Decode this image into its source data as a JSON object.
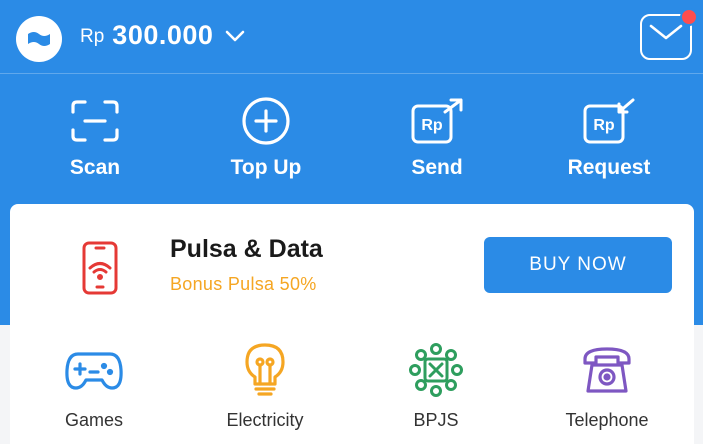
{
  "header": {
    "logo_icon": "wallet-logo-icon",
    "balance": {
      "currency": "Rp",
      "amount": "300.000"
    },
    "inbox_icon": "mail-icon",
    "has_notification": true
  },
  "quick_actions": [
    {
      "label": "Scan",
      "icon": "scan-icon"
    },
    {
      "label": "Top Up",
      "icon": "plus-circle-icon"
    },
    {
      "label": "Send",
      "icon": "rp-send-icon"
    },
    {
      "label": "Request",
      "icon": "rp-request-icon"
    }
  ],
  "promo": {
    "icon": "phone-wifi-icon",
    "title": "Pulsa & Data",
    "subtitle": "Bonus Pulsa 50%",
    "button_label": "BUY NOW"
  },
  "services": [
    {
      "label": "Games",
      "icon": "gamepad-icon"
    },
    {
      "label": "Electricity",
      "icon": "lightbulb-icon"
    },
    {
      "label": "BPJS",
      "icon": "bpjs-icon"
    },
    {
      "label": "Telephone",
      "icon": "telephone-icon"
    }
  ],
  "colors": {
    "primary": "#2b8be6",
    "accent_orange": "#f5a623",
    "notification": "#ff4d4f",
    "promo_icon": "#e53935",
    "games_icon": "#2b8be6",
    "electricity_icon": "#f5a623",
    "bpjs_icon": "#2e9e5e",
    "telephone_icon": "#7e57c2"
  }
}
